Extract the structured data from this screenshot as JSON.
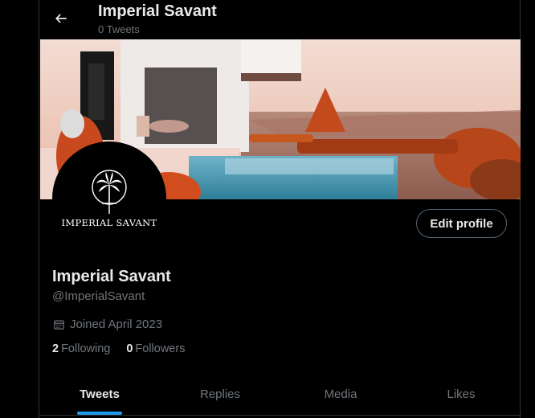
{
  "header": {
    "title": "Imperial Savant",
    "tweet_count": "0 Tweets"
  },
  "avatar": {
    "logo_text": "IMPERIAL SAVANT"
  },
  "edit_profile_label": "Edit profile",
  "profile": {
    "name": "Imperial Savant",
    "handle": "@ImperialSavant",
    "joined": "Joined April 2023",
    "following_count": "2",
    "following_label": "Following",
    "followers_count": "0",
    "followers_label": "Followers"
  },
  "tabs": [
    {
      "label": "Tweets",
      "active": true
    },
    {
      "label": "Replies",
      "active": false
    },
    {
      "label": "Media",
      "active": false
    },
    {
      "label": "Likes",
      "active": false
    }
  ],
  "colors": {
    "background": "#000000",
    "accent": "#1d9bf0",
    "text_primary": "#e7e9ea",
    "text_secondary": "#71767b",
    "border": "#2f3336"
  },
  "icons": {
    "back": "arrow-left-icon",
    "calendar": "calendar-icon",
    "palm": "palm-tree-icon"
  }
}
